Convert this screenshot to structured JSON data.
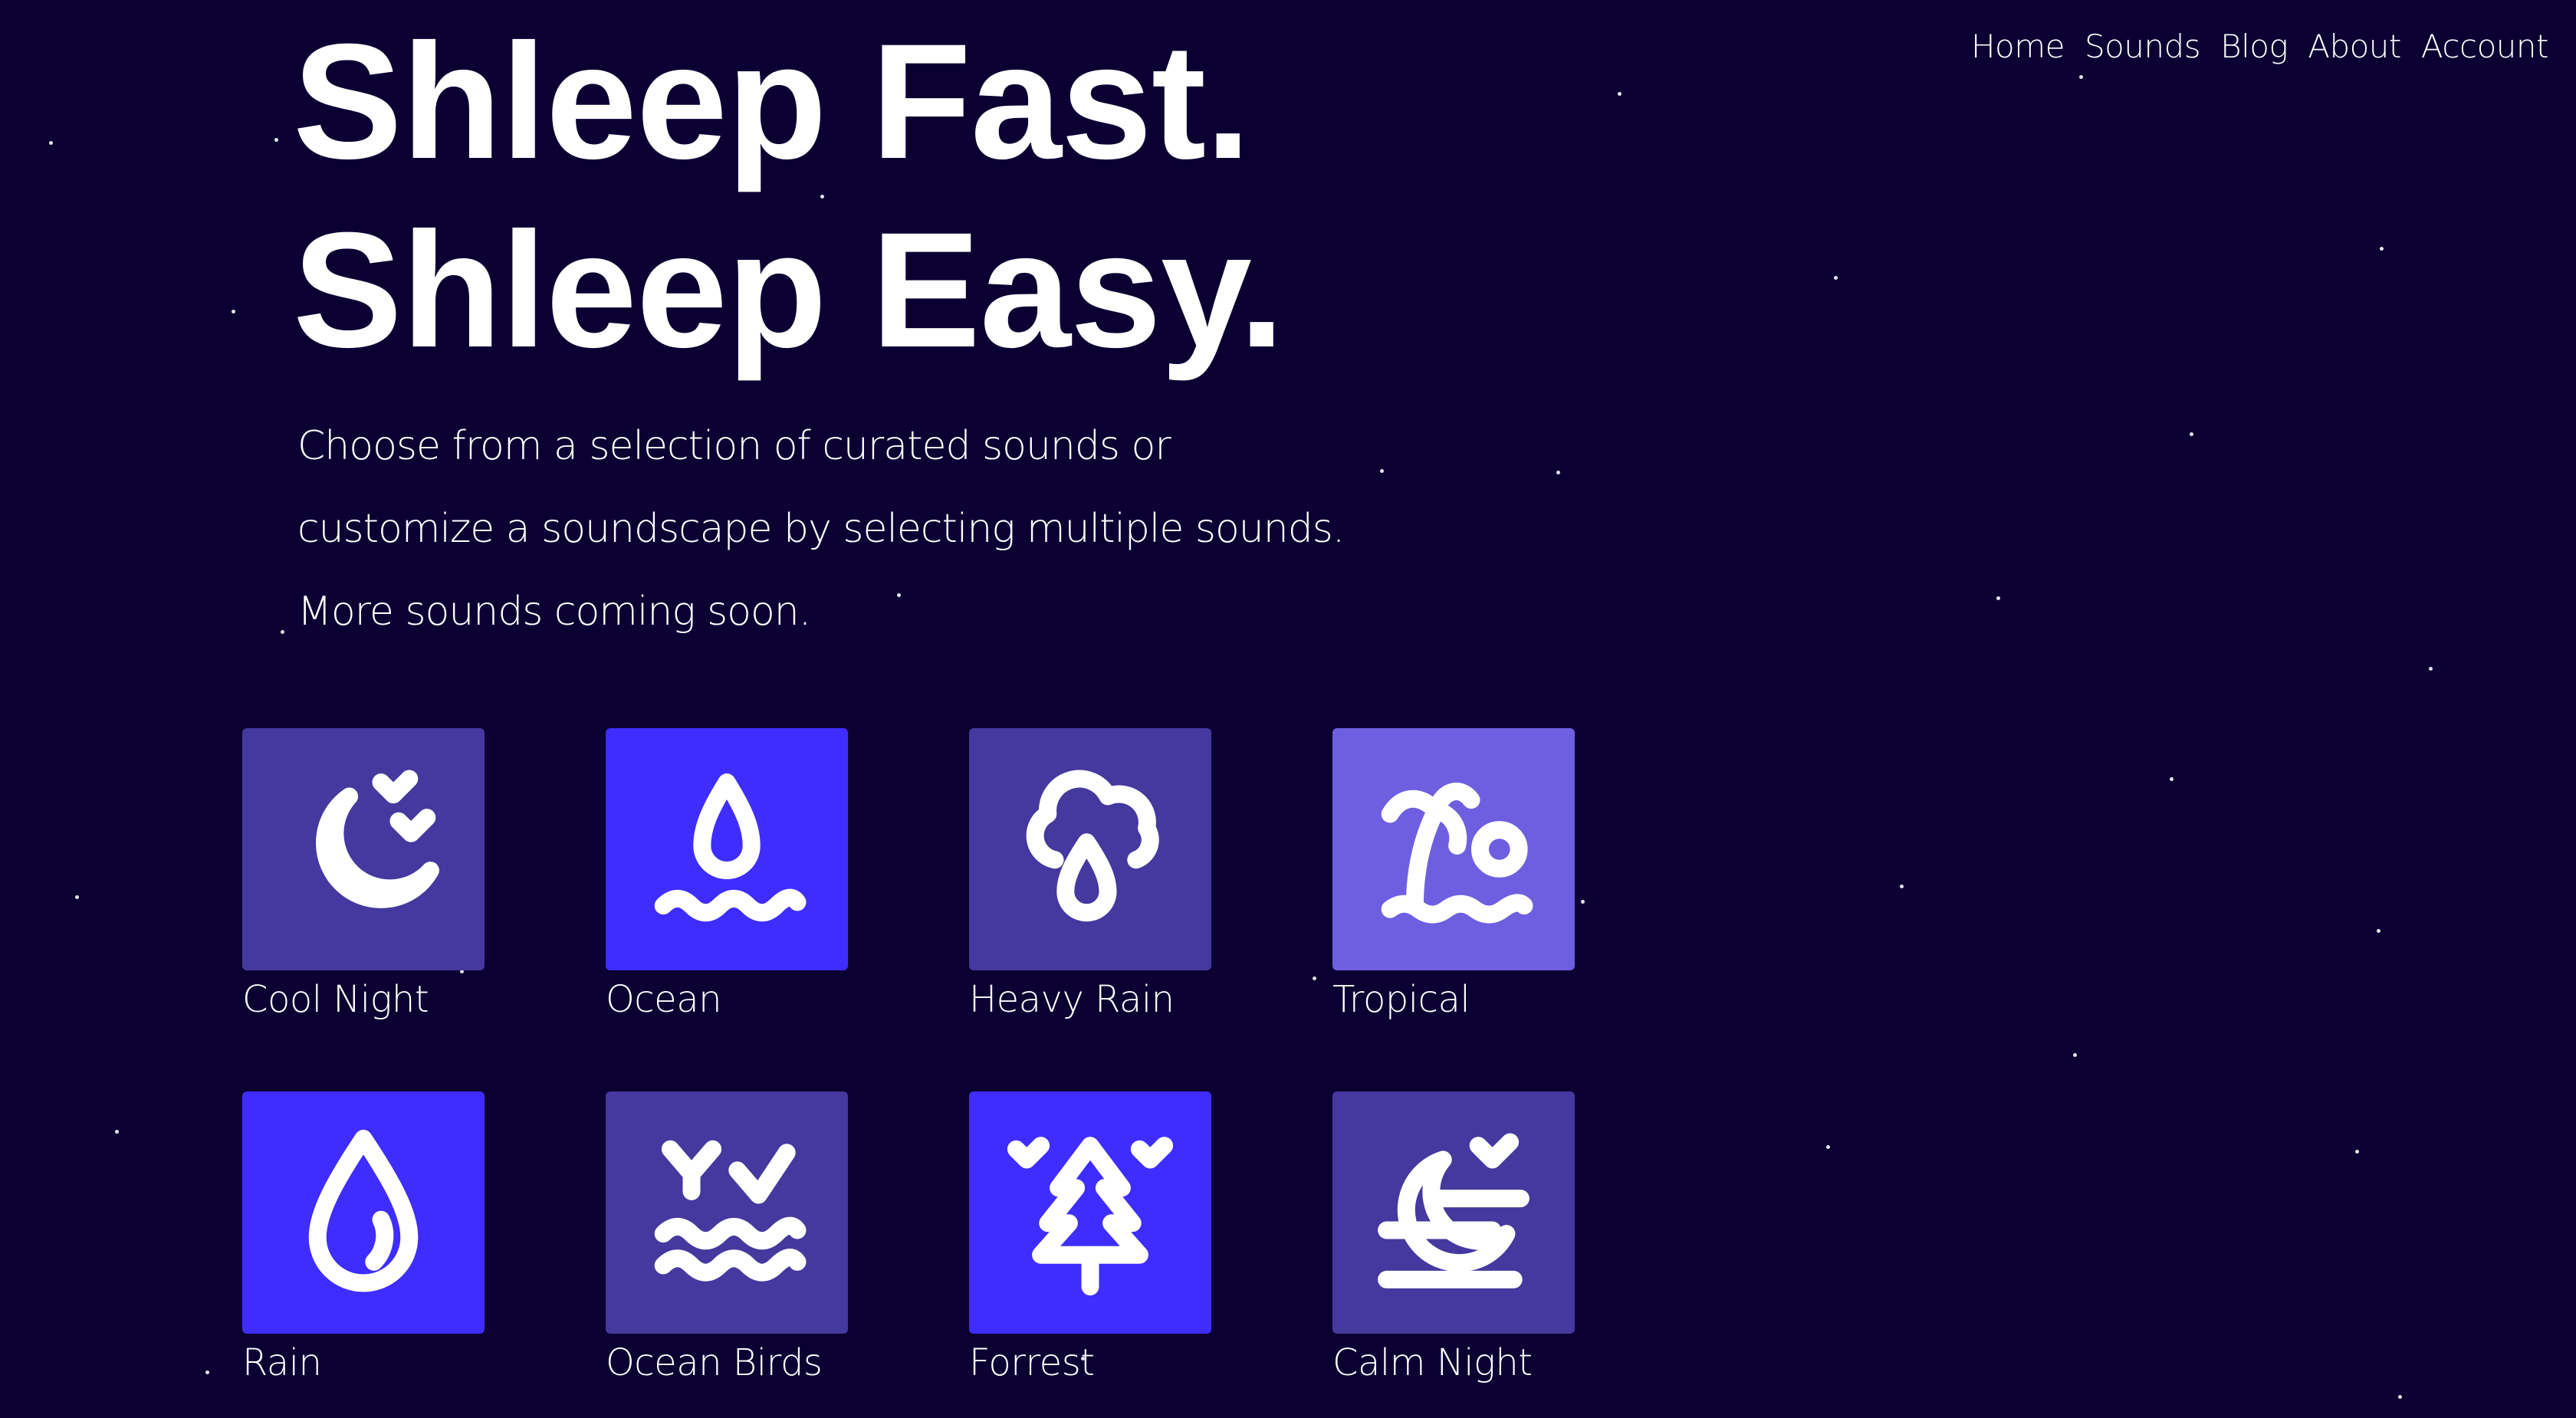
{
  "nav": {
    "items": [
      "Home",
      "Sounds",
      "Blog",
      "About",
      "Account"
    ]
  },
  "hero": {
    "title_line1": "Shleep Fast.",
    "title_line2": "Shleep Easy.",
    "description_lines": [
      "Choose from a selection of curated sounds or",
      "customize a soundscape by selecting multiple sounds.",
      "More sounds coming soon."
    ]
  },
  "sounds": [
    {
      "label": "Cool Night",
      "icon": "moon-birds-icon",
      "color": "#45389e"
    },
    {
      "label": "Ocean",
      "icon": "water-drop-waves-icon",
      "color": "#3f2dff"
    },
    {
      "label": "Heavy Rain",
      "icon": "cloud-rain-icon",
      "color": "#45389e"
    },
    {
      "label": "Tropical",
      "icon": "palm-tree-sun-icon",
      "color": "#6e5fe0"
    },
    {
      "label": "Rain",
      "icon": "raindrop-icon",
      "color": "#3f2dff"
    },
    {
      "label": "Ocean Birds",
      "icon": "birds-waves-icon",
      "color": "#45389e"
    },
    {
      "label": "Forrest",
      "icon": "pine-tree-birds-icon",
      "color": "#3f2dff"
    },
    {
      "label": "Calm Night",
      "icon": "moon-clouds-icon",
      "color": "#45389e"
    }
  ],
  "colors": {
    "background": "#0b0032",
    "tile_dark": "#45389e",
    "tile_bright": "#3f2dff",
    "tile_light": "#6e5fe0",
    "text": "#ffffff"
  }
}
